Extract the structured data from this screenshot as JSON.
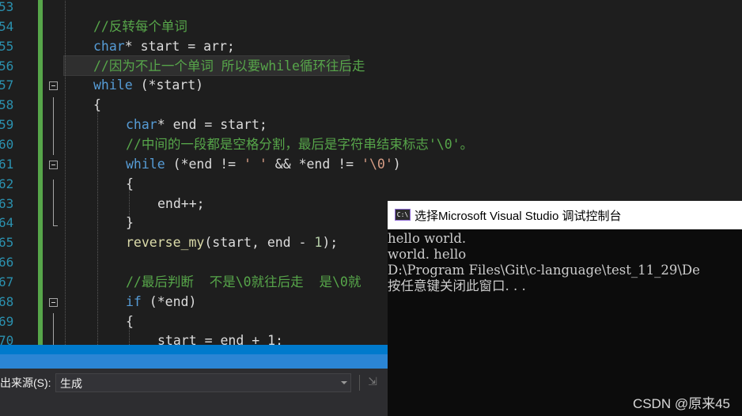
{
  "editor": {
    "line_numbers": [
      "53",
      "54",
      "55",
      "56",
      "57",
      "58",
      "59",
      "60",
      "61",
      "62",
      "63",
      "64",
      "65",
      "66",
      "67",
      "68",
      "69",
      "70"
    ],
    "lines": [
      {
        "segments": []
      },
      {
        "segments": [
          {
            "t": "//反转每个单词",
            "c": "cm"
          }
        ]
      },
      {
        "segments": [
          {
            "t": "char",
            "c": "kw"
          },
          {
            "t": "* start = arr;",
            "c": "tx"
          }
        ]
      },
      {
        "segments": [
          {
            "t": "//因为不止一个单词 所以要while循环往后走",
            "c": "cm"
          }
        ]
      },
      {
        "segments": [
          {
            "t": "while",
            "c": "kw"
          },
          {
            "t": " (*start)",
            "c": "tx"
          }
        ]
      },
      {
        "segments": [
          {
            "t": "{",
            "c": "tx"
          }
        ]
      },
      {
        "segments": [
          {
            "t": "char",
            "c": "kw"
          },
          {
            "t": "* end = start;",
            "c": "tx"
          }
        ]
      },
      {
        "segments": [
          {
            "t": "//中间的一段都是空格分割，最后是字符串结束标志'\\0'。",
            "c": "cm"
          }
        ]
      },
      {
        "segments": [
          {
            "t": "while",
            "c": "kw"
          },
          {
            "t": " (*end != ",
            "c": "tx"
          },
          {
            "t": "' '",
            "c": "st"
          },
          {
            "t": " && *end != ",
            "c": "tx"
          },
          {
            "t": "'\\0'",
            "c": "st"
          },
          {
            "t": ")",
            "c": "tx"
          }
        ]
      },
      {
        "segments": [
          {
            "t": "{",
            "c": "tx"
          }
        ]
      },
      {
        "segments": [
          {
            "t": "end++;",
            "c": "tx"
          }
        ]
      },
      {
        "segments": [
          {
            "t": "}",
            "c": "tx"
          }
        ]
      },
      {
        "segments": [
          {
            "t": "reverse_my",
            "c": "fn"
          },
          {
            "t": "(start, end - ",
            "c": "tx"
          },
          {
            "t": "1",
            "c": "nm"
          },
          {
            "t": ");",
            "c": "tx"
          }
        ]
      },
      {
        "segments": []
      },
      {
        "segments": [
          {
            "t": "//最后判断  不是\\0就往后走  是\\0就",
            "c": "cm"
          }
        ]
      },
      {
        "segments": [
          {
            "t": "if",
            "c": "kw"
          },
          {
            "t": " (*end)",
            "c": "tx"
          }
        ]
      },
      {
        "segments": [
          {
            "t": "{",
            "c": "tx"
          }
        ]
      },
      {
        "segments": [
          {
            "t": "start = end + 1;",
            "c": "tx"
          }
        ]
      }
    ]
  },
  "output": {
    "source_label": "出来源(S):",
    "source_value": "生成"
  },
  "console": {
    "title": "选择Microsoft Visual Studio 调试控制台",
    "icon_text": "C:\\",
    "lines": [
      "hello world.",
      "world. hello",
      "D:\\Program Files\\Git\\c-language\\test_11_29\\De",
      "按任意键关闭此窗口. . ."
    ]
  },
  "watermark": "CSDN @原来45",
  "colors": {
    "keyword": "#569cd6",
    "comment": "#57a64a",
    "function": "#dcdcaa",
    "string": "#d69d85",
    "number": "#b5cea8",
    "text": "#dcdcdc",
    "line_number": "#2b91af",
    "accent_blue": "#007acc"
  }
}
